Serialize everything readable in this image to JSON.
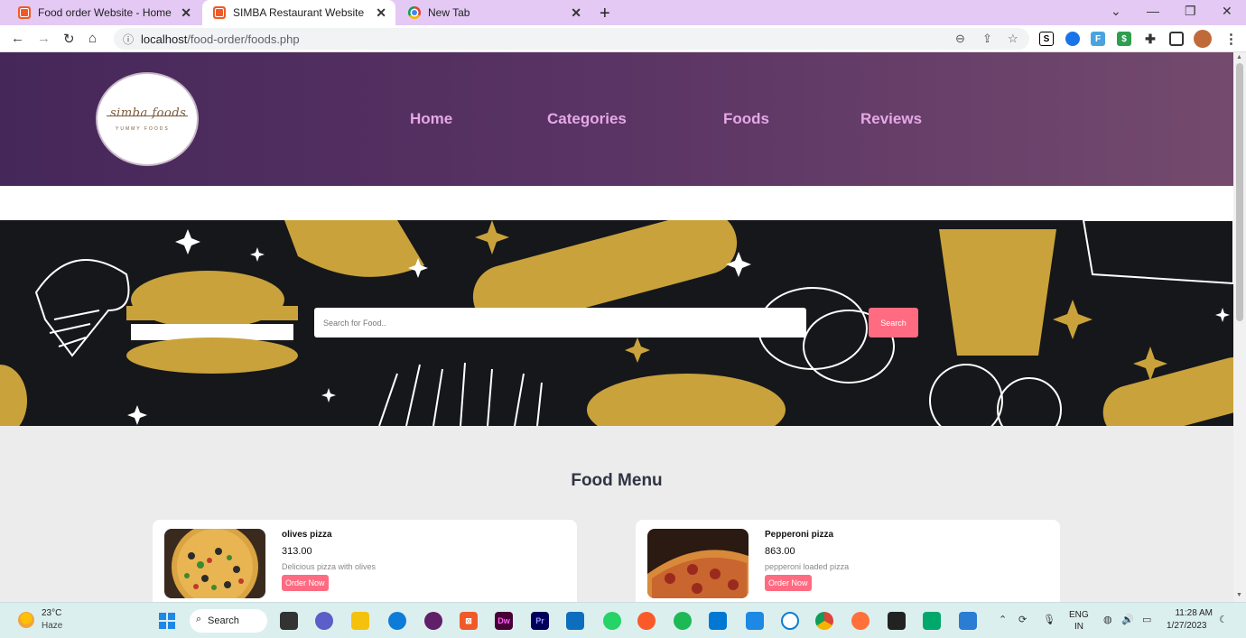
{
  "browser": {
    "tabs": [
      {
        "title": "Food order Website - Home page",
        "active": false
      },
      {
        "title": "SIMBA Restaurant Website",
        "active": true
      },
      {
        "title": "New Tab",
        "active": false
      }
    ],
    "url_host": "localhost",
    "url_path": "/food-order/foods.php",
    "new_tab": "+",
    "close": "✕"
  },
  "site": {
    "logo_script": "simba foods",
    "logo_sub": "YUMMY FOODS",
    "menu": [
      "Home",
      "Categories",
      "Foods",
      "Reviews"
    ]
  },
  "search": {
    "placeholder": "Search for Food..",
    "button": "Search"
  },
  "menu_section": {
    "title": "Food Menu",
    "foods": [
      {
        "name": "olives pizza",
        "price": "313.00",
        "desc": "Delicious pizza with olives",
        "button": "Order Now"
      },
      {
        "name": "Pepperoni pizza",
        "price": "863.00",
        "desc": " pepperoni loaded pizza",
        "button": "Order Now"
      }
    ]
  },
  "taskbar": {
    "temp": "23°C",
    "weather": "Haze",
    "search": "Search",
    "lang": "ENG",
    "region": "IN",
    "time": "11:28 AM",
    "date": "1/27/2023"
  },
  "colors": {
    "accent": "#ff6b81",
    "header_start": "#46275a",
    "header_end": "#744a6e",
    "menu_link": "#e6a8e6",
    "hero_bg": "#15171a",
    "hero_gold": "#c9a23b"
  }
}
